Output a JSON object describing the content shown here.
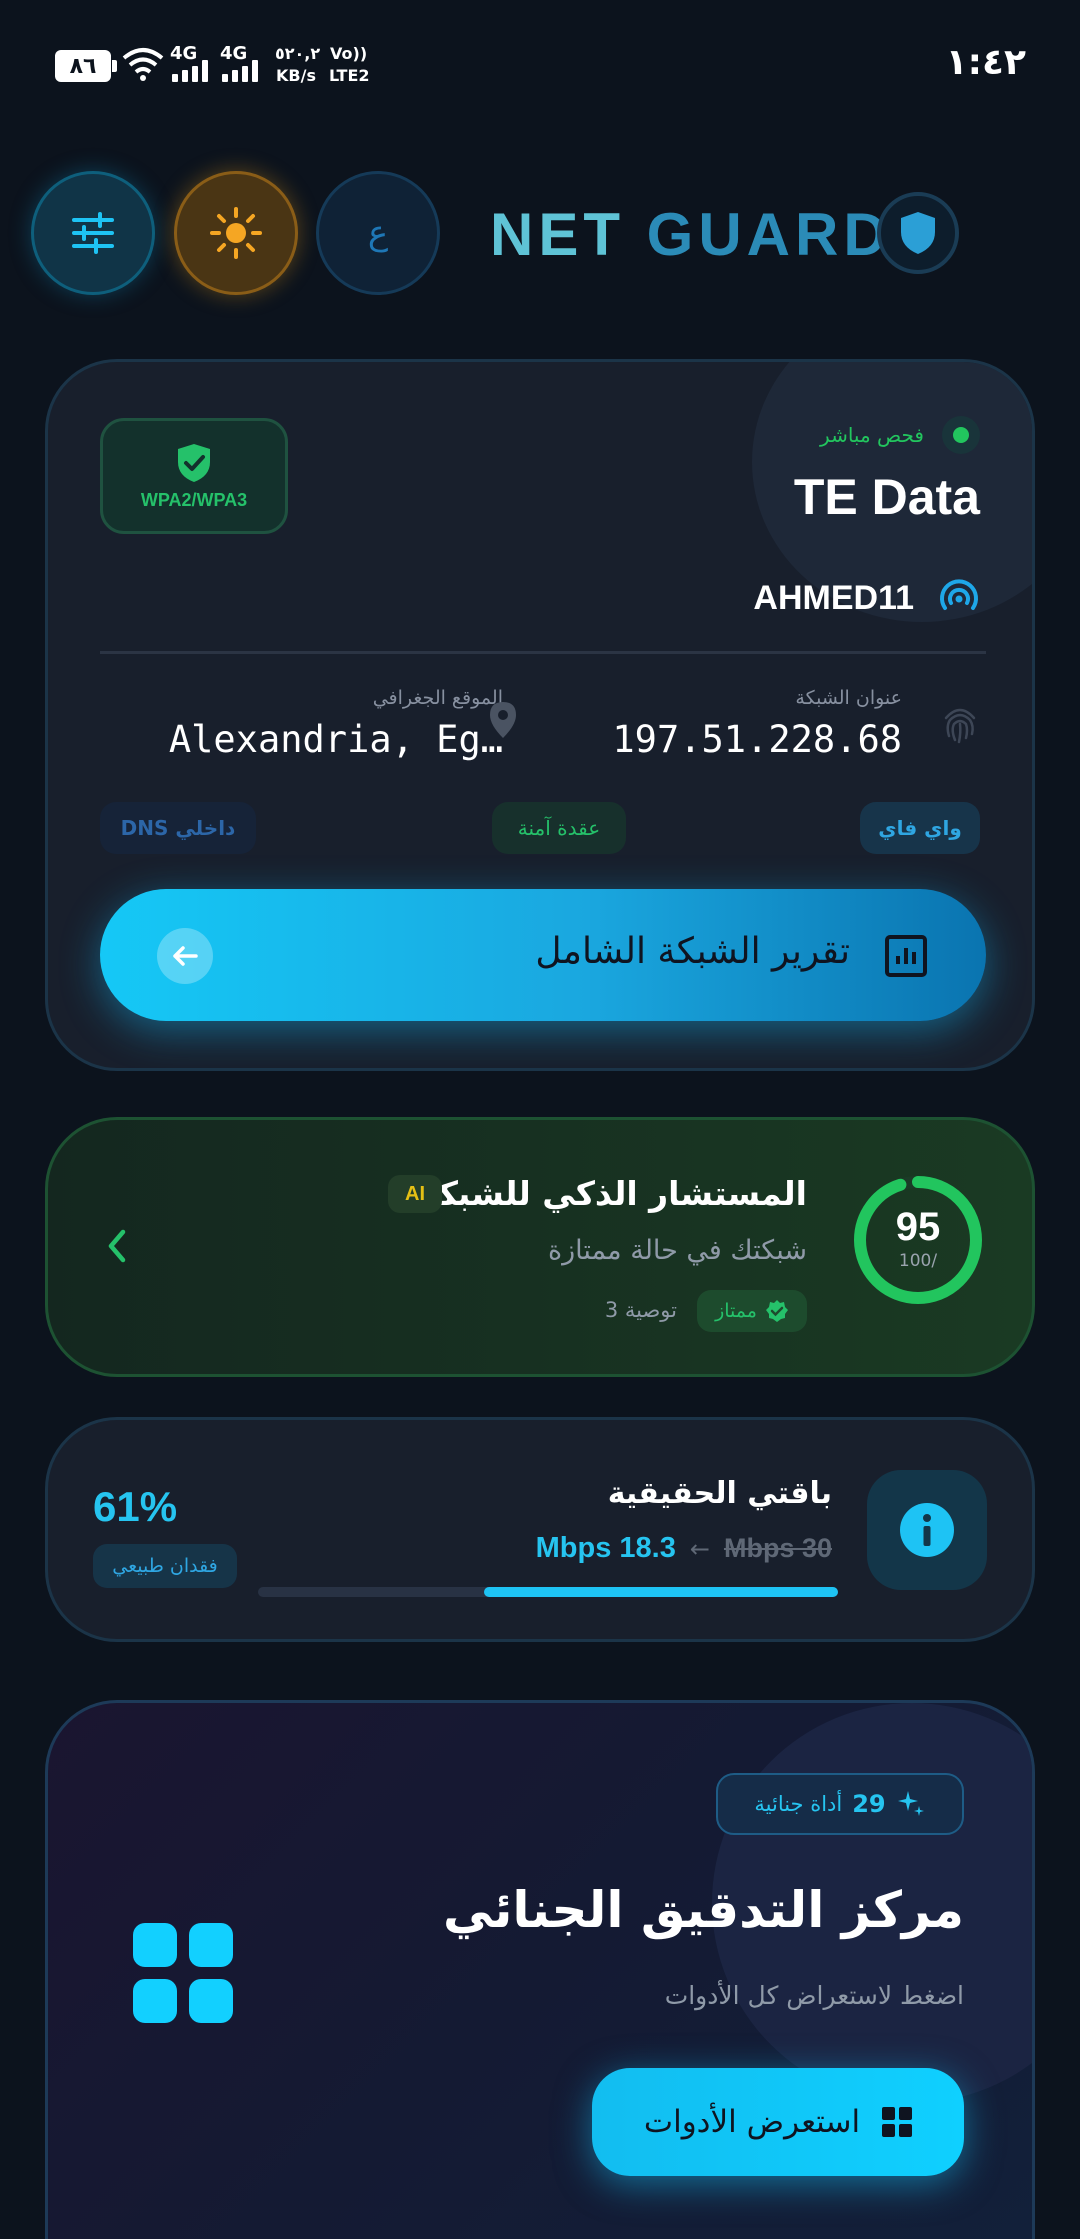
{
  "status_bar": {
    "battery": "٨٦",
    "network_1": "4G",
    "network_2": "4G",
    "speed_value": "٥٢٠,٢",
    "speed_unit": "KB/s",
    "volte": "Vo))",
    "lte": "LTE2",
    "time": "١:٤٢"
  },
  "header": {
    "language_toggle": "ع",
    "brand_part1": "NET",
    "brand_part2": "GUARD",
    "icons": [
      "sliders-icon",
      "sun-icon",
      "shield-icon"
    ]
  },
  "network_card": {
    "security_badge": "WPA2/WPA3",
    "live_label": "فحص مباشر",
    "isp": "TE Data",
    "ssid": "AHMED11",
    "ip_label": "عنوان الشبكة",
    "ip_value": "197.51.228.68",
    "location_label": "الموقع الجغرافي",
    "location_value": "Alexandria, Eg…",
    "tags": {
      "wifi": "واي فاي",
      "secure_node": "عقدة آمنة",
      "dns": "DNS داخلي"
    },
    "report_button": "تقرير الشبكة الشامل"
  },
  "ai_card": {
    "title": "المستشار الذكي للشبكة",
    "badge": "AI",
    "subtitle": "شبكتك في حالة ممتازة",
    "status_label": "ممتاز",
    "recommendations": "3 توصية",
    "score": 95,
    "score_max": "100/"
  },
  "plan_card": {
    "title": "باقتي الحقيقية",
    "old_speed": "Mbps 30",
    "arrow": "←",
    "new_speed": "Mbps 18.3",
    "progress_fraction": 0.61,
    "loss_percent": "61%",
    "loss_label": "فقدان طبيعي"
  },
  "forensic_card": {
    "tools_count": "29",
    "tools_label": "أداة جنائية",
    "title": "مركز التدقيق الجنائي",
    "subtitle": "اضغط لاستعراض كل الأدوات",
    "browse_button": "استعرض الأدوات"
  },
  "colors": {
    "background": "#0c131d",
    "accent_cyan": "#1ec3f4",
    "success_green": "#22c55e",
    "theme_orange": "#f5a623"
  }
}
